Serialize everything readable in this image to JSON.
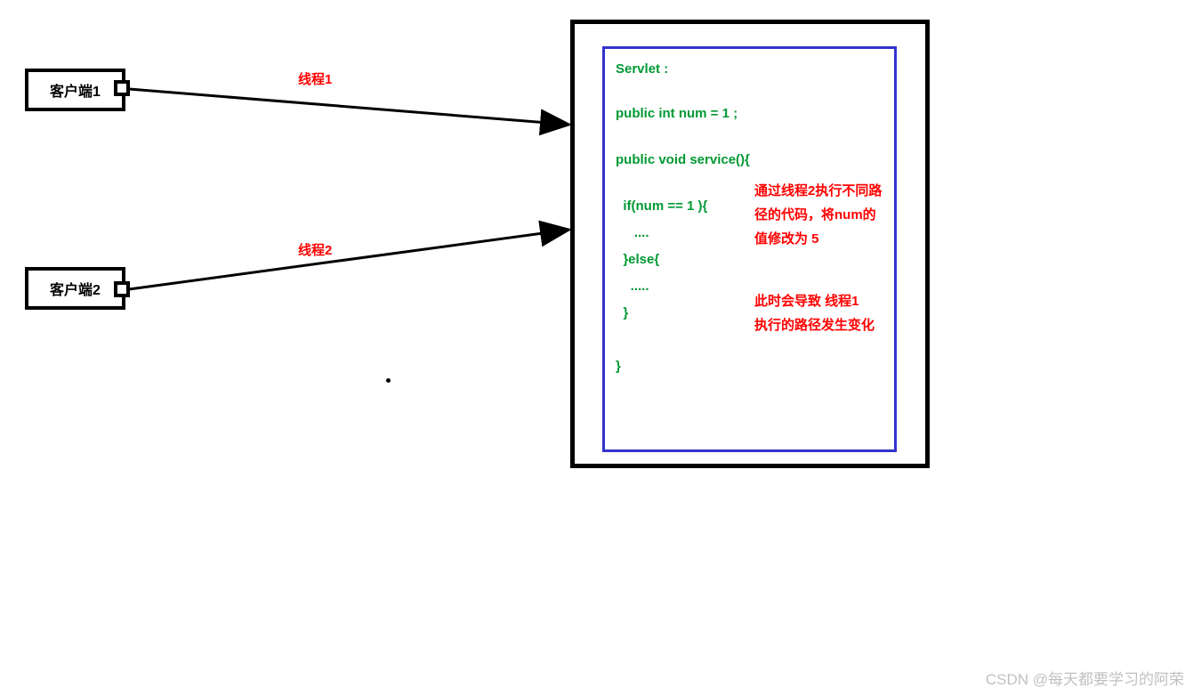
{
  "clients": {
    "client1": "客户端1",
    "client2": "客户端2"
  },
  "threads": {
    "thread1": "线程1",
    "thread2": "线程2"
  },
  "code": {
    "l1": "Servlet :",
    "l2": "public int num = 1 ;",
    "l3": "public void service(){",
    "l4": "  if(num == 1 ){",
    "l5": "     ....",
    "l6": "  }else{",
    "l7": "    .....",
    "l8": "  }",
    "l9": "}"
  },
  "annotations": {
    "note1_line1": "通过线程2执行不同路",
    "note1_line2": "径的代码，将num的",
    "note1_line3": "值修改为 5",
    "note2_line1": "此时会导致 线程1",
    "note2_line2": "执行的路径发生变化"
  },
  "watermark": "CSDN @每天都要学习的阿荣"
}
